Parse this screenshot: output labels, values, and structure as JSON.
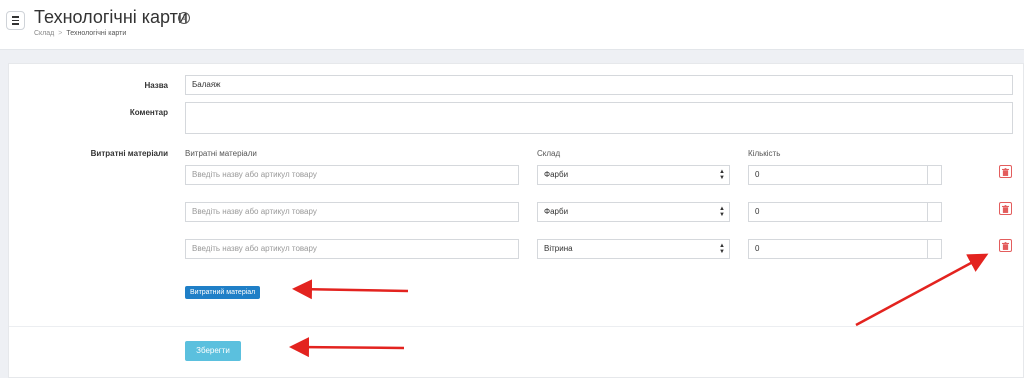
{
  "header": {
    "title": "Технологічні карти",
    "info_icon": "i",
    "breadcrumb": [
      "Склад",
      "Технологічні карти"
    ]
  },
  "form": {
    "name_label": "Назва",
    "name_value": "Балаяж",
    "comment_label": "Коментар",
    "comment_value": "",
    "materials_label": "Витратні матеріали",
    "columns": [
      "Витратні матеріали",
      "Склад",
      "Кількість"
    ],
    "rows": [
      {
        "product_placeholder": "Введіть назву або артикул товару",
        "warehouse": "Фарби",
        "quantity": "0"
      },
      {
        "product_placeholder": "Введіть назву або артикул товару",
        "warehouse": "Фарби",
        "quantity": "0"
      },
      {
        "product_placeholder": "Введіть назву або артикул товару",
        "warehouse": "Вітрина",
        "quantity": "0"
      }
    ],
    "add_material_label": "Витратний матеріал",
    "save_label": "Зберегти"
  },
  "colors": {
    "accent_blue": "#1f7fc7",
    "save_button": "#5bc0de",
    "delete_red": "#e35d5d",
    "annotation_arrow": "#e3231f"
  },
  "icons": {
    "menu": "menu-icon",
    "info": "info-icon",
    "delete": "trash-icon",
    "select_caret": "updown-caret-icon"
  }
}
